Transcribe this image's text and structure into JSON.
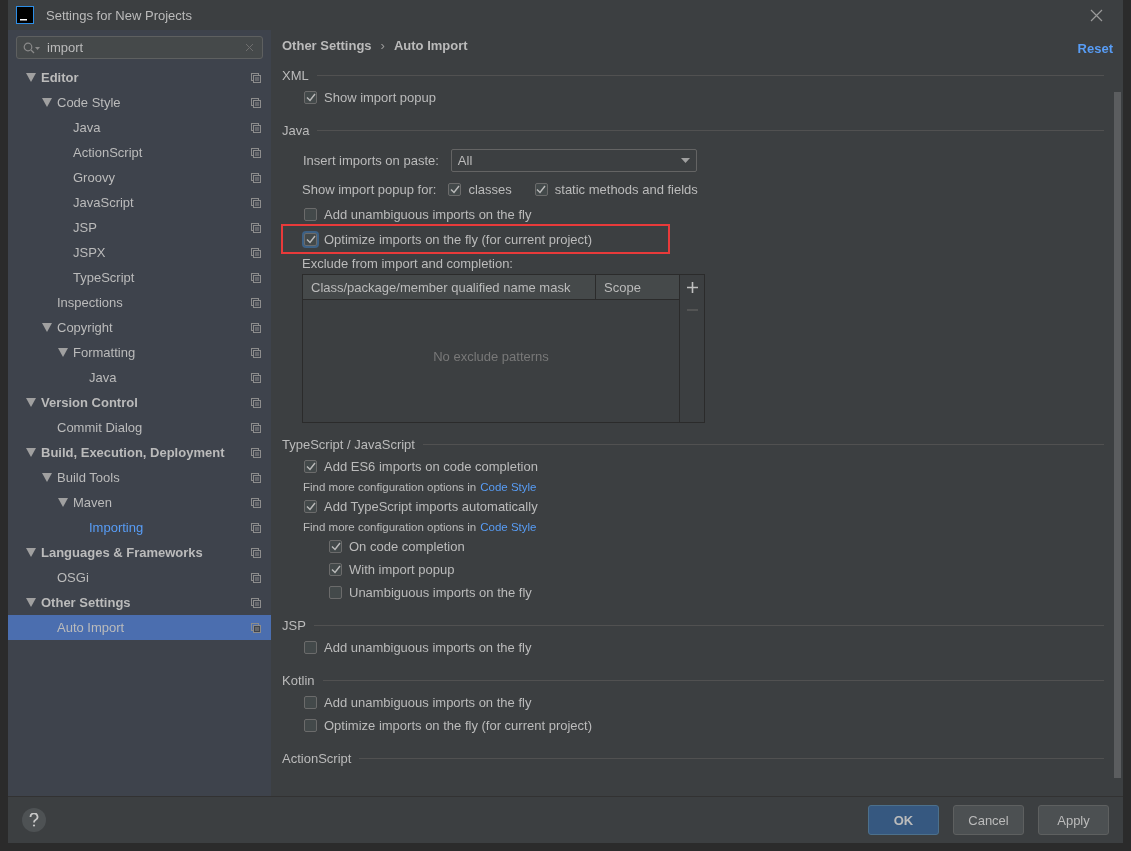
{
  "window": {
    "title": "Settings for New Projects"
  },
  "search": {
    "value": "import"
  },
  "tree": [
    {
      "label": "Editor",
      "expanded": true,
      "selected": false,
      "match": false,
      "children": [
        {
          "label": "Code Style",
          "expanded": true,
          "selected": false,
          "match": false,
          "children": [
            {
              "label": "Java",
              "selected": false,
              "match": false
            },
            {
              "label": "ActionScript",
              "selected": false,
              "match": false
            },
            {
              "label": "Groovy",
              "selected": false,
              "match": false
            },
            {
              "label": "JavaScript",
              "selected": false,
              "match": false
            },
            {
              "label": "JSP",
              "selected": false,
              "match": false
            },
            {
              "label": "JSPX",
              "selected": false,
              "match": false
            },
            {
              "label": "TypeScript",
              "selected": false,
              "match": false
            }
          ]
        },
        {
          "label": "Inspections",
          "selected": false,
          "match": false
        },
        {
          "label": "Copyright",
          "expanded": true,
          "selected": false,
          "match": false,
          "children": [
            {
              "label": "Formatting",
              "expanded": true,
              "selected": false,
              "match": false,
              "children": [
                {
                  "label": "Java",
                  "selected": false,
                  "match": false
                }
              ]
            }
          ]
        }
      ]
    },
    {
      "label": "Version Control",
      "expanded": true,
      "selected": false,
      "match": false,
      "children": [
        {
          "label": "Commit Dialog",
          "selected": false,
          "match": false
        }
      ]
    },
    {
      "label": "Build, Execution, Deployment",
      "expanded": true,
      "selected": false,
      "match": false,
      "children": [
        {
          "label": "Build Tools",
          "expanded": true,
          "selected": false,
          "match": false,
          "children": [
            {
              "label": "Maven",
              "expanded": true,
              "selected": false,
              "match": false,
              "children": [
                {
                  "label": "Importing",
                  "selected": false,
                  "match": true
                }
              ]
            }
          ]
        }
      ]
    },
    {
      "label": "Languages & Frameworks",
      "expanded": true,
      "selected": false,
      "match": false,
      "children": [
        {
          "label": "OSGi",
          "selected": false,
          "match": false
        }
      ]
    },
    {
      "label": "Other Settings",
      "expanded": true,
      "selected": false,
      "match": false,
      "children": [
        {
          "label": "Auto Import",
          "selected": true,
          "match": false
        }
      ]
    }
  ],
  "breadcrumb": [
    "Other Settings",
    "›",
    "Auto Import"
  ],
  "reset": "Reset",
  "sections": [
    {
      "title": "XML",
      "items": [
        {
          "kind": "checkbox",
          "label": "Show import popup",
          "checked": true
        }
      ]
    },
    {
      "title": "Java",
      "items": [
        {
          "kind": "dropdown",
          "label": "Insert imports on paste:",
          "value": "All"
        },
        {
          "kind": "checkgroup",
          "label": "Show import popup for:",
          "options": [
            {
              "label": "classes",
              "checked": true
            },
            {
              "label": "static methods and fields",
              "checked": true
            }
          ]
        },
        {
          "kind": "checkbox",
          "label": "Add unambiguous imports on the fly",
          "checked": false
        },
        {
          "kind": "checkbox",
          "label": "Optimize imports on the fly (for current project)",
          "checked": true,
          "highlighted": true
        },
        {
          "kind": "table",
          "label": "Exclude from import and completion:",
          "columns": [
            "Class/package/member qualified name mask",
            "Scope"
          ],
          "empty_text": "No exclude patterns"
        }
      ]
    },
    {
      "title": "TypeScript / JavaScript",
      "items": [
        {
          "kind": "checkbox",
          "label": "Add ES6 imports on code completion",
          "checked": true,
          "note": {
            "text": "Find more configuration options in",
            "link": "Code Style"
          }
        },
        {
          "kind": "checkbox",
          "label": "Add TypeScript imports automatically",
          "checked": true,
          "note": {
            "text": "Find more configuration options in",
            "link": "Code Style"
          },
          "children": [
            {
              "label": "On code completion",
              "checked": true
            },
            {
              "label": "With import popup",
              "checked": true
            },
            {
              "label": "Unambiguous imports on the fly",
              "checked": false
            }
          ]
        }
      ]
    },
    {
      "title": "JSP",
      "items": [
        {
          "kind": "checkbox",
          "label": "Add unambiguous imports on the fly",
          "checked": false
        }
      ]
    },
    {
      "title": "Kotlin",
      "items": [
        {
          "kind": "checkbox",
          "label": "Add unambiguous imports on the fly",
          "checked": false
        },
        {
          "kind": "checkbox",
          "label": "Optimize imports on the fly (for current project)",
          "checked": false
        }
      ]
    },
    {
      "title": "ActionScript"
    }
  ],
  "buttons": [
    {
      "label": "OK",
      "default": true
    },
    {
      "label": "Cancel",
      "default": false
    },
    {
      "label": "Apply",
      "default": false
    }
  ]
}
